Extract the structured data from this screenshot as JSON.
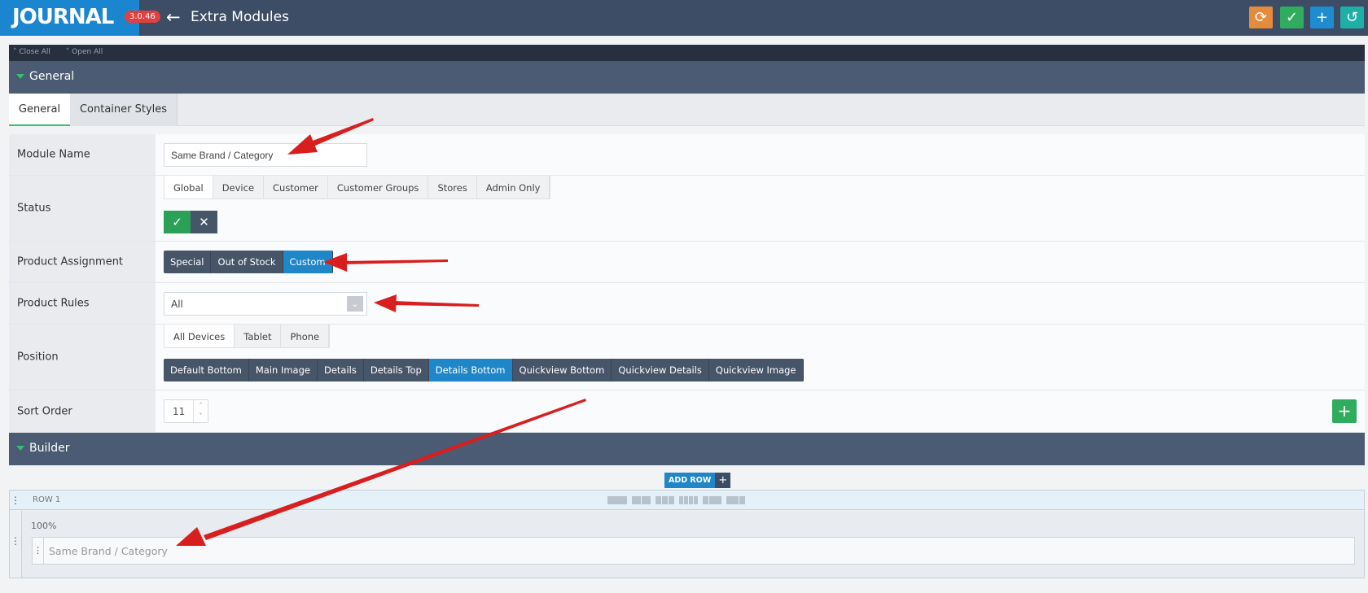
{
  "header": {
    "logo": "JOURNAL",
    "version": "3.0.46",
    "title": "Extra Modules",
    "buttons": [
      "reset-icon",
      "check-icon",
      "plus-icon",
      "history-icon"
    ]
  },
  "toolbar": {
    "close_all": "Close All",
    "open_all": "Open All"
  },
  "sections": {
    "general": "General",
    "builder": "Builder"
  },
  "main_tabs": [
    {
      "label": "General"
    },
    {
      "label": "Container Styles"
    }
  ],
  "fields": {
    "module_name": {
      "label": "Module Name",
      "value": "Same Brand / Category"
    },
    "status": {
      "label": "Status",
      "tabs": [
        "Global",
        "Device",
        "Customer",
        "Customer Groups",
        "Stores",
        "Admin Only"
      ],
      "active_tab": "Global",
      "value": "on"
    },
    "product_assignment": {
      "label": "Product Assignment",
      "options": [
        "Special",
        "Out of Stock",
        "Custom"
      ],
      "selected": "Custom"
    },
    "product_rules": {
      "label": "Product Rules",
      "value": "All"
    },
    "position": {
      "label": "Position",
      "tabs": [
        "All Devices",
        "Tablet",
        "Phone"
      ],
      "active_tab": "All Devices",
      "options": [
        "Default Bottom",
        "Main Image",
        "Details",
        "Details Top",
        "Details Bottom",
        "Quickview Bottom",
        "Quickview Details",
        "Quickview Image"
      ],
      "selected": "Details Bottom"
    },
    "sort_order": {
      "label": "Sort Order",
      "value": "11"
    }
  },
  "builder": {
    "add_row_label": "ADD ROW",
    "row_label": "ROW 1",
    "column_width": "100%",
    "module_name": "Same Brand / Category"
  },
  "colors": {
    "header_bg": "#3d4d65",
    "logo_bg": "#1a86d0",
    "accent_green": "#2fac5d",
    "accent_blue": "#1f86c8",
    "annotation_red": "#d81e1e"
  }
}
